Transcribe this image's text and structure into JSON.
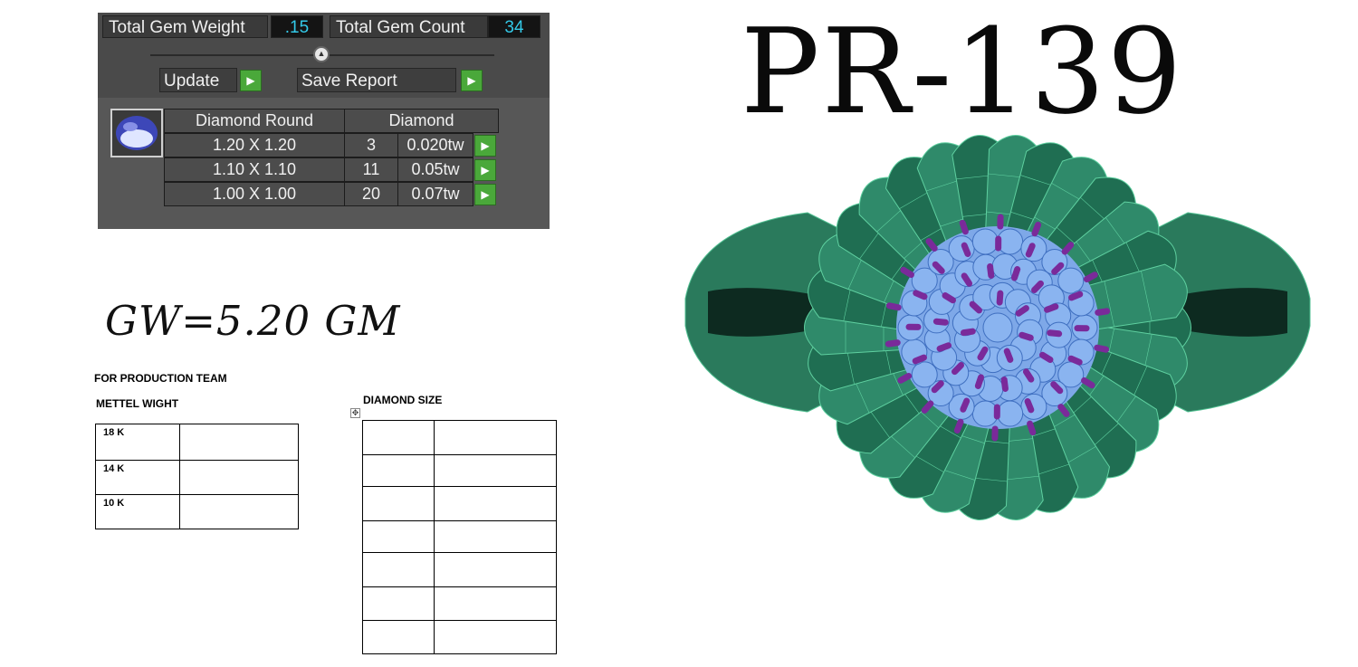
{
  "gem_panel": {
    "total_weight_label": "Total Gem Weight",
    "total_weight_value": ".15",
    "total_count_label": "Total Gem Count",
    "total_count_value": "34",
    "update_label": "Update",
    "save_report_label": "Save Report",
    "table_header": {
      "shape": "Diamond Round",
      "type": "Diamond"
    },
    "rows": [
      {
        "size": "1.20 X 1.20",
        "count": "3",
        "weight": "0.020tw"
      },
      {
        "size": "1.10 X 1.10",
        "count": "11",
        "weight": "0.05tw"
      },
      {
        "size": "1.00 X 1.00",
        "count": "20",
        "weight": "0.07tw"
      }
    ]
  },
  "gross_weight": "GW=5.20 GM",
  "production": {
    "team_label": "FOR PRODUCTION TEAM",
    "metal_label": "METTEL WIGHT",
    "metal_rows": [
      "18 K",
      "14 K",
      "10 K"
    ],
    "diamond_label": "DIAMOND SIZE"
  },
  "product_code": "PR-139",
  "colors": {
    "ring_green": "#2f8a6a",
    "ring_green_dark": "#1f6e52",
    "gem_blue": "#8ab4f0",
    "prong_purple": "#7a2a9a",
    "value_cyan": "#33c9e8",
    "arrow_green": "#4aa83a"
  }
}
